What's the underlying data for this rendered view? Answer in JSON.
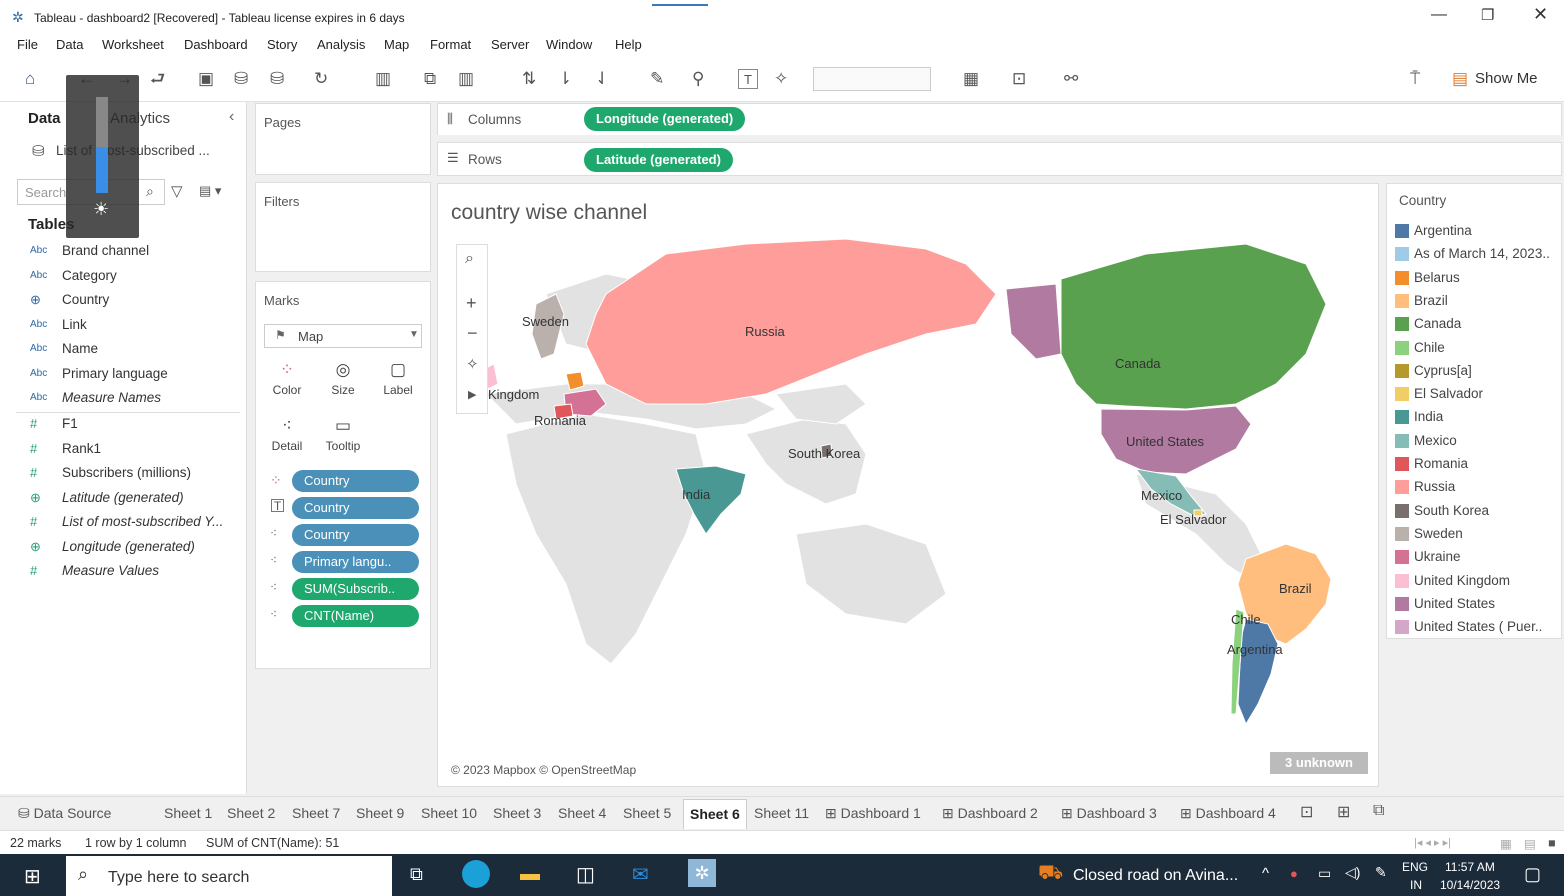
{
  "window": {
    "title": "Tableau - dashboard2 [Recovered] - Tableau license expires in 6 days"
  },
  "menu": [
    "File",
    "Data",
    "Worksheet",
    "Dashboard",
    "Story",
    "Analysis",
    "Map",
    "Format",
    "Server",
    "Window",
    "Help"
  ],
  "toolbar": {
    "show_me": "Show Me"
  },
  "data_pane": {
    "tab_data": "Data",
    "tab_analytics": "Analytics",
    "datasource": "List of most-subscribed ...",
    "search_placeholder": "Search",
    "tables_heading": "Tables",
    "fields": [
      {
        "icon": "Abc",
        "name": "Brand channel"
      },
      {
        "icon": "Abc",
        "name": "Category"
      },
      {
        "icon": "globe",
        "name": "Country"
      },
      {
        "icon": "Abc",
        "name": "Link"
      },
      {
        "icon": "Abc",
        "name": "Name"
      },
      {
        "icon": "Abc",
        "name": "Primary language"
      },
      {
        "icon": "Abc",
        "name": "Measure Names"
      },
      {
        "icon": "#",
        "name": "F1"
      },
      {
        "icon": "#",
        "name": "Rank1"
      },
      {
        "icon": "#",
        "name": "Subscribers (millions)"
      },
      {
        "icon": "globe",
        "name": "Latitude (generated)"
      },
      {
        "icon": "#",
        "name": "List of most-subscribed Y..."
      },
      {
        "icon": "globe",
        "name": "Longitude (generated)"
      },
      {
        "icon": "#",
        "name": "Measure Values"
      }
    ]
  },
  "pages": {
    "title": "Pages"
  },
  "filters": {
    "title": "Filters"
  },
  "marks": {
    "title": "Marks",
    "type": "Map",
    "buttons": [
      "Color",
      "Size",
      "Label",
      "Detail",
      "Tooltip"
    ],
    "pills": [
      {
        "label": "Country",
        "kind": "color"
      },
      {
        "label": "Country",
        "kind": "label"
      },
      {
        "label": "Country",
        "kind": "detail"
      },
      {
        "label": "Primary langu..",
        "kind": "detail"
      },
      {
        "label": "SUM(Subscrib..",
        "kind": "detail"
      },
      {
        "label": "CNT(Name)",
        "kind": "detail"
      }
    ]
  },
  "shelves": {
    "columns_label": "Columns",
    "columns_pill": "Longitude (generated)",
    "rows_label": "Rows",
    "rows_pill": "Latitude (generated)"
  },
  "view": {
    "title": "country wise channel",
    "attribution": "© 2023 Mapbox © OpenStreetMap",
    "unknown": "3 unknown",
    "labels": {
      "russia": "Russia",
      "sweden": "Sweden",
      "kingdom": "Kingdom",
      "romania": "Romania",
      "south_korea": "South Korea",
      "india": "India",
      "canada": "Canada",
      "united_states": "United States",
      "mexico": "Mexico",
      "el_salvador": "El Salvador",
      "brazil": "Brazil",
      "chile": "Chile",
      "argentina": "Argentina"
    }
  },
  "legend": {
    "title": "Country",
    "items": [
      {
        "label": "Argentina",
        "color": "#4e79a7"
      },
      {
        "label": "As of March 14, 2023..",
        "color": "#a0cbe8"
      },
      {
        "label": "Belarus",
        "color": "#f28e2b"
      },
      {
        "label": "Brazil",
        "color": "#ffbe7d"
      },
      {
        "label": "Canada",
        "color": "#59a14f"
      },
      {
        "label": "Chile",
        "color": "#8cd17d"
      },
      {
        "label": "Cyprus[a]",
        "color": "#b6992d"
      },
      {
        "label": "El Salvador",
        "color": "#f1ce63"
      },
      {
        "label": "India",
        "color": "#499894"
      },
      {
        "label": "Mexico",
        "color": "#86bcb6"
      },
      {
        "label": "Romania",
        "color": "#e15759"
      },
      {
        "label": "Russia",
        "color": "#ff9d9a"
      },
      {
        "label": "South Korea",
        "color": "#79706e"
      },
      {
        "label": "Sweden",
        "color": "#bab0ac"
      },
      {
        "label": "Ukraine",
        "color": "#d37295"
      },
      {
        "label": "United Kingdom",
        "color": "#fabfd2"
      },
      {
        "label": "United States",
        "color": "#b07aa1"
      },
      {
        "label": "United States ( Puer..",
        "color": "#d4a6c8"
      }
    ]
  },
  "sheet_tabs": {
    "data_source": "Data Source",
    "sheets": [
      "Sheet 1",
      "Sheet 2",
      "Sheet 7",
      "Sheet 9",
      "Sheet 10",
      "Sheet 3",
      "Sheet 4",
      "Sheet 5",
      "Sheet 6",
      "Sheet 11",
      "Dashboard 1",
      "Dashboard 2",
      "Dashboard 3",
      "Dashboard 4"
    ],
    "active": "Sheet 6"
  },
  "status": {
    "marks": "22 marks",
    "rows": "1 row by 1 column",
    "sum": "SUM of CNT(Name): 51"
  },
  "taskbar": {
    "search_placeholder": "Type here to search",
    "news": "Closed road on Avina...",
    "lang": "ENG",
    "region": "IN",
    "time": "11:57 AM",
    "date": "10/14/2023"
  }
}
